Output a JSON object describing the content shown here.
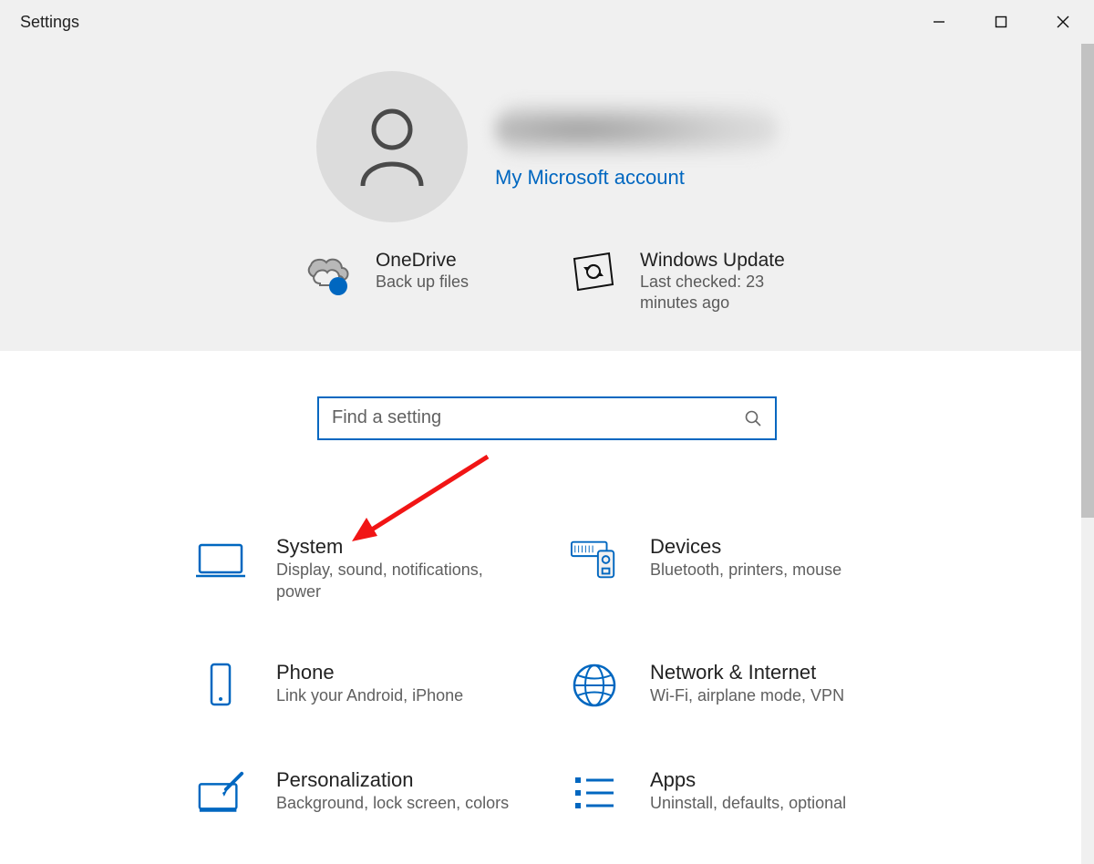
{
  "window": {
    "title": "Settings"
  },
  "account": {
    "name_blurred": true,
    "link": "My Microsoft account"
  },
  "status_cards": [
    {
      "title": "OneDrive",
      "subtitle": "Back up files"
    },
    {
      "title": "Windows Update",
      "subtitle": "Last checked: 23 minutes ago"
    }
  ],
  "search": {
    "placeholder": "Find a setting"
  },
  "categories": [
    {
      "id": "system",
      "title": "System",
      "subtitle": "Display, sound, notifications, power"
    },
    {
      "id": "devices",
      "title": "Devices",
      "subtitle": "Bluetooth, printers, mouse"
    },
    {
      "id": "phone",
      "title": "Phone",
      "subtitle": "Link your Android, iPhone"
    },
    {
      "id": "network",
      "title": "Network & Internet",
      "subtitle": "Wi-Fi, airplane mode, VPN"
    },
    {
      "id": "personalization",
      "title": "Personalization",
      "subtitle": "Background, lock screen, colors"
    },
    {
      "id": "apps",
      "title": "Apps",
      "subtitle": "Uninstall, defaults, optional"
    }
  ],
  "colors": {
    "accent": "#0067c0",
    "arrow": "#f11515"
  }
}
